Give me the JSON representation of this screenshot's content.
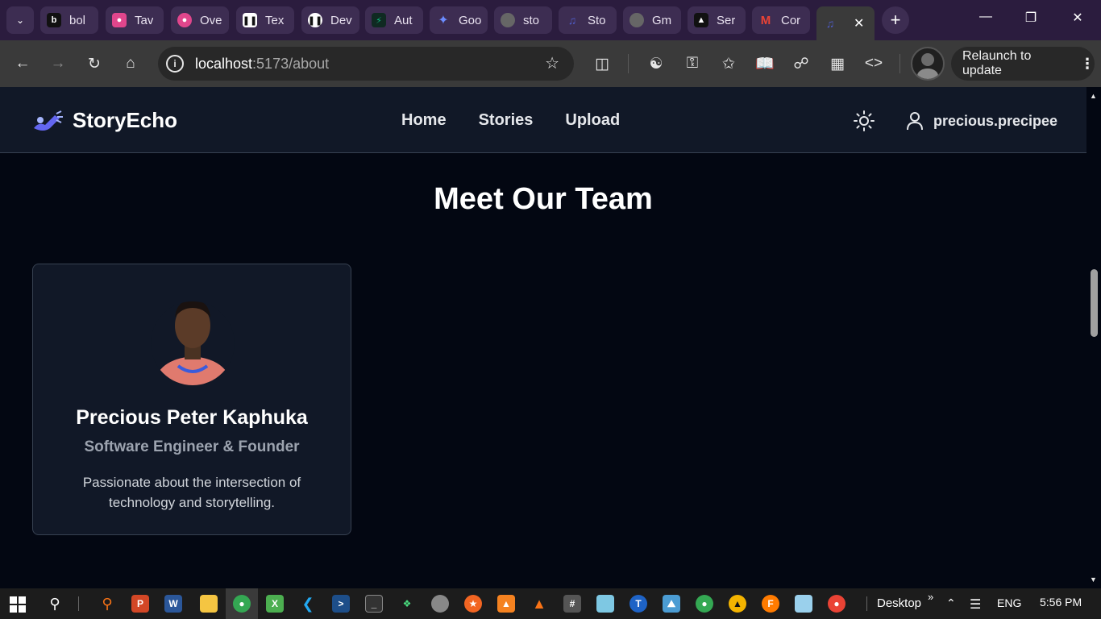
{
  "tabs": [
    {
      "label": "bol",
      "favicon": "bolt-icon",
      "color": "#111111"
    },
    {
      "label": "Tav",
      "favicon": "tavily-icon",
      "color": "#e0468c"
    },
    {
      "label": "Ove",
      "favicon": "ovo-icon",
      "color": "#e0468c"
    },
    {
      "label": "Tex",
      "favicon": "pause-icon",
      "color": "#ffffff"
    },
    {
      "label": "Dev",
      "favicon": "pause-icon",
      "color": "#ffffff"
    },
    {
      "label": "Aut",
      "favicon": "bolt-green-icon",
      "color": "#10b981"
    },
    {
      "label": "Goo",
      "favicon": "gemini-icon",
      "color": "#6b8cff"
    },
    {
      "label": "sto",
      "favicon": "globe-icon",
      "color": "#777777"
    },
    {
      "label": "Sto",
      "favicon": "storyecho-icon",
      "color": "#4f5cc9"
    },
    {
      "label": "Gm",
      "favicon": "globe-icon",
      "color": "#777777"
    },
    {
      "label": "Ser",
      "favicon": "render-icon",
      "color": "#111111"
    },
    {
      "label": "Cor",
      "favicon": "gmail-icon",
      "color": "#ffffff"
    }
  ],
  "active_tab": {
    "favicon": "storyecho-icon"
  },
  "browser": {
    "url_host": "localhost",
    "url_path": ":5173/about",
    "relaunch_label": "Relaunch to update"
  },
  "site": {
    "brand": "StoryEcho",
    "nav": [
      {
        "label": "Home"
      },
      {
        "label": "Stories"
      },
      {
        "label": "Upload"
      }
    ],
    "username": "precious.precipee"
  },
  "about": {
    "heading": "Meet Our Team",
    "member": {
      "name": "Precious Peter Kaphuka",
      "role": "Software Engineer & Founder",
      "bio": "Passionate about the intersection of technology and storytelling."
    }
  },
  "taskbar": {
    "desktop_label": "Desktop",
    "chevron": "»",
    "language": "ENG",
    "time": "5:56 PM"
  },
  "colors": {
    "page_bg": "#030712",
    "navbar_bg": "#111827",
    "card_bg": "#111827",
    "border": "#374151",
    "accent_logo": "#6366f1"
  }
}
